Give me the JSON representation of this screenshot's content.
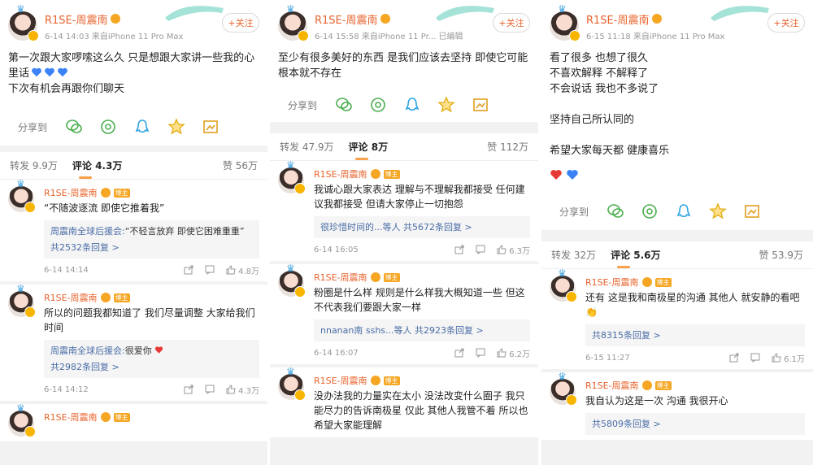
{
  "panels": [
    {
      "user": "R1SE-周震南",
      "time": "6-14 14:03",
      "source": "来自iPhone 11 Pro Max",
      "follow": "+关注",
      "lines": [
        "第一次跟大家啰嗦这么久 只是想跟大家讲一些我的心里话",
        "下次有机会再跟你们聊天"
      ],
      "share_label": "分享到",
      "tabs": {
        "repost": "转发 9.9万",
        "comment": "评论 4.3万",
        "likes": "赞 56万"
      },
      "comments": [
        {
          "name": "R1SE-周震南",
          "tag": "博主",
          "text": "“不随波逐流 即使它推着我”",
          "reply_name": "周震南全球后援会:",
          "reply_text": "“不轻言放弃 即使它困难重重”",
          "reply_more": "共2532条回复 >",
          "time": "6-14 14:14",
          "likes": "4.8万"
        },
        {
          "name": "R1SE-周震南",
          "tag": "博主",
          "text": "所以的问题我都知道了 我们尽量调整 大家给我们时间",
          "reply_name": "周震南全球后援会:",
          "reply_text": "很爱你",
          "reply_more": "共2982条回复 >",
          "time": "6-14 14:12",
          "likes": "4.3万"
        },
        {
          "name": "R1SE-周震南",
          "tag": "博主",
          "text": "",
          "time": "",
          "likes": ""
        }
      ]
    },
    {
      "user": "R1SE-周震南",
      "time": "6-14 15:58",
      "source": "来自iPhone 11 Pr...",
      "edited": "已编辑",
      "follow": "+关注",
      "lines": [
        "至少有很多美好的东西 是我们应该去坚持 即使它可能根本就不存在"
      ],
      "share_label": "分享到",
      "tabs": {
        "repost": "转发 47.9万",
        "comment": "评论 8万",
        "likes": "赞 112万"
      },
      "comments": [
        {
          "name": "R1SE-周震南",
          "tag": "博主",
          "text": "我诚心跟大家表达 理解与不理解我都接受 任何建议我都接受 但请大家停止一切抱怨",
          "reply_inline": "很珍惜时间的...等人",
          "reply_more": "共5672条回复 >",
          "time": "6-14 16:05",
          "likes": "6.3万"
        },
        {
          "name": "R1SE-周震南",
          "tag": "博主",
          "text": "粉圈是什么样 规则是什么样我大概知道一些 但这不代表我们要跟大家一样",
          "reply_inline": "nnanan南 sshs...等人",
          "reply_more": "共2923条回复 >",
          "time": "6-14 16:07",
          "likes": "6.2万"
        },
        {
          "name": "R1SE-周震南",
          "tag": "博主",
          "text": "没办法我的力量实在太小 没法改变什么圈子 我只能尽力的告诉南极星 仅此 其他人我管不着 所以也希望大家能理解",
          "time": "",
          "likes": ""
        }
      ]
    },
    {
      "user": "R1SE-周震南",
      "time": "6-15 11:18",
      "source": "来自iPhone 11 Pro Max",
      "follow": "+关注",
      "lines": [
        "看了很多 也想了很久",
        "不喜欢解释 不解释了",
        "不会说话 我也不多说了",
        "",
        "坚持自己所认同的",
        "",
        "希望大家每天都 健康喜乐"
      ],
      "share_label": "分享到",
      "tabs": {
        "repost": "转发 32万",
        "comment": "评论 5.6万",
        "likes": "赞 53.9万"
      },
      "comments": [
        {
          "name": "R1SE-周震南",
          "tag": "博主",
          "text": "还有 这是我和南极星的沟通 其他人 就安静的看吧",
          "reply_more": "共8315条回复 >",
          "time": "6-15 11:27",
          "likes": "6.1万"
        },
        {
          "name": "R1SE-周震南",
          "tag": "博主",
          "text": "我自认为这是一次 沟通 我很开心",
          "reply_more": "共5809条回复 >",
          "time": "",
          "likes": ""
        }
      ]
    }
  ],
  "colors": {
    "name": "#e8632d",
    "link": "#4a6da7",
    "tab_underline": "#f8a04b",
    "blue_heart": "#3b82f6",
    "red_heart": "#e53935"
  }
}
